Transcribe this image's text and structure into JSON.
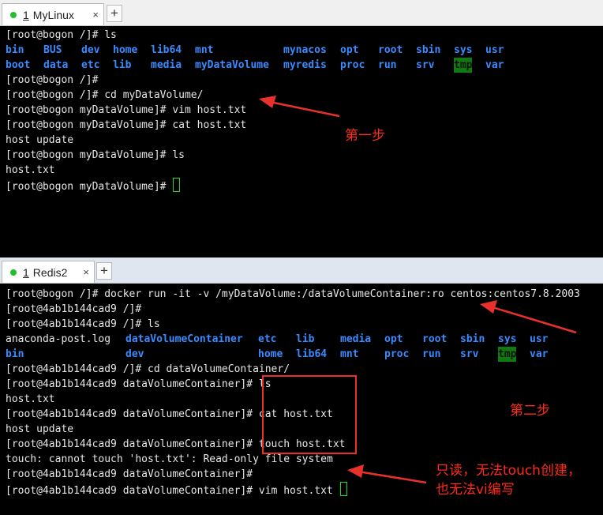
{
  "colors": {
    "prompt_text": "#e6e6e6",
    "dir_blue": "#3a8bff",
    "tmp_highlight": "#0f7a0f",
    "annotation_red": "#ff2a1a",
    "status_dot": "#22c02a"
  },
  "icons": {
    "status": "green-dot-icon",
    "close": "close-icon",
    "new_tab": "plus-icon",
    "cursor": "block-cursor-icon"
  },
  "pane1": {
    "tab": {
      "number": "1",
      "title": "MyLinux",
      "close": "×"
    },
    "new_tab": "+",
    "lines": [
      "[root@bogon /]# ls",
      "[root@bogon /]#",
      "[root@bogon /]# cd myDataVolume/",
      "[root@bogon myDataVolume]# vim host.txt",
      "[root@bogon myDataVolume]# cat host.txt",
      "host update",
      "[root@bogon myDataVolume]# ls",
      "host.txt",
      "[root@bogon myDataVolume]# "
    ],
    "ls_row1": [
      "bin",
      "BUS",
      "dev",
      "home",
      "lib64",
      "mnt",
      "mynacos",
      "opt",
      "root",
      "sbin",
      "sys",
      "usr"
    ],
    "ls_row2": [
      "boot",
      "data",
      "etc",
      "lib",
      "media",
      "myDataVolume",
      "myredis",
      "proc",
      "run",
      "srv",
      "tmp",
      "var"
    ],
    "annotation": "第一步"
  },
  "pane2": {
    "tab": {
      "number": "1",
      "title": "Redis2",
      "close": "×"
    },
    "new_tab": "+",
    "lines": [
      "[root@bogon /]# docker run -it -v /myDataVolume:/dataVolumeContainer:ro centos:centos7.8.2003",
      "[root@4ab1b144cad9 /]#",
      "[root@4ab1b144cad9 /]# ls",
      "[root@4ab1b144cad9 /]# cd dataVolumeContainer/",
      "[root@4ab1b144cad9 dataVolumeContainer]# ls",
      "host.txt",
      "[root@4ab1b144cad9 dataVolumeContainer]# cat host.txt",
      "host update",
      "[root@4ab1b144cad9 dataVolumeContainer]# touch host.txt",
      "touch: cannot touch 'host.txt': Read-only file system",
      "[root@4ab1b144cad9 dataVolumeContainer]#",
      "[root@4ab1b144cad9 dataVolumeContainer]# vim host.txt "
    ],
    "ls_row1": [
      "anaconda-post.log",
      "dataVolumeContainer",
      "etc",
      "lib",
      "media",
      "opt",
      "root",
      "sbin",
      "sys",
      "usr"
    ],
    "ls_row2": [
      "bin",
      "dev",
      "home",
      "lib64",
      "mnt",
      "proc",
      "run",
      "srv",
      "tmp",
      "var"
    ],
    "annotation_step2": "第二步",
    "annotation_readonly_1": "只读，无法touch创建，",
    "annotation_readonly_2": "也无法vi编写"
  }
}
